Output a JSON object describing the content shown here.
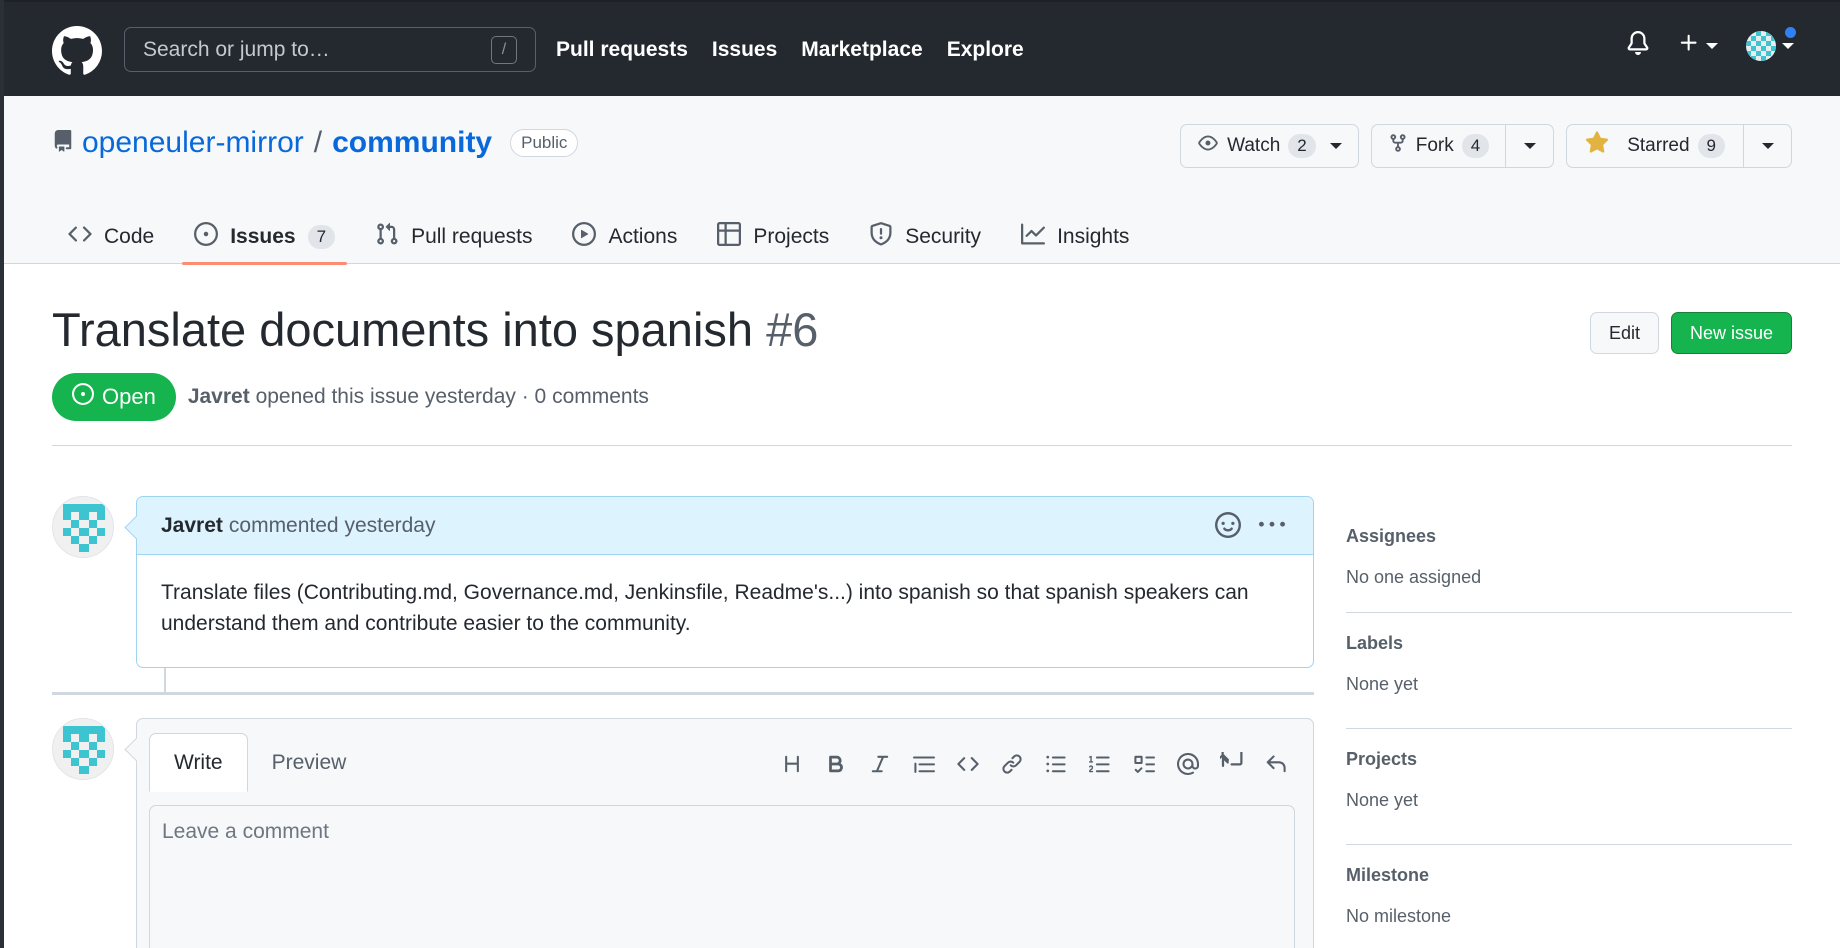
{
  "header": {
    "search_placeholder": "Search or jump to…",
    "slash_key": "/",
    "nav": [
      "Pull requests",
      "Issues",
      "Marketplace",
      "Explore"
    ]
  },
  "repo": {
    "owner": "openeuler-mirror",
    "separator": "/",
    "name": "community",
    "visibility": "Public",
    "watch_label": "Watch",
    "watch_count": "2",
    "fork_label": "Fork",
    "fork_count": "4",
    "star_label": "Starred",
    "star_count": "9",
    "tabs": [
      {
        "label": "Code",
        "icon": "code-icon"
      },
      {
        "label": "Issues",
        "icon": "issue-opened-icon",
        "count": "7"
      },
      {
        "label": "Pull requests",
        "icon": "git-pull-request-icon"
      },
      {
        "label": "Actions",
        "icon": "play-icon"
      },
      {
        "label": "Projects",
        "icon": "table-icon"
      },
      {
        "label": "Security",
        "icon": "shield-icon"
      },
      {
        "label": "Insights",
        "icon": "graph-icon"
      }
    ]
  },
  "issue": {
    "title": "Translate documents into spanish",
    "number": "#6",
    "edit_label": "Edit",
    "new_issue_label": "New issue",
    "state": "Open",
    "author": "Javret",
    "meta_text": "opened this issue yesterday · 0 comments"
  },
  "comment": {
    "author": "Javret",
    "action": "commented yesterday",
    "body": "Translate files (Contributing.md, Governance.md, Jenkinsfile, Readme's...) into spanish so that spanish speakers can understand them and contribute easier to the community."
  },
  "composer": {
    "write_tab": "Write",
    "preview_tab": "Preview",
    "placeholder": "Leave a comment"
  },
  "sidebar": {
    "assignees_heading": "Assignees",
    "assignees_value": "No one assigned",
    "labels_heading": "Labels",
    "labels_value": "None yet",
    "projects_heading": "Projects",
    "projects_value": "None yet",
    "milestone_heading": "Milestone",
    "milestone_value": "No milestone"
  },
  "colors": {
    "header_bg": "#24292f",
    "link": "#0969da",
    "open_green": "#15b44e",
    "selected_tab_underline": "#fd8c73",
    "comment_header_bg": "#ddf4ff"
  }
}
